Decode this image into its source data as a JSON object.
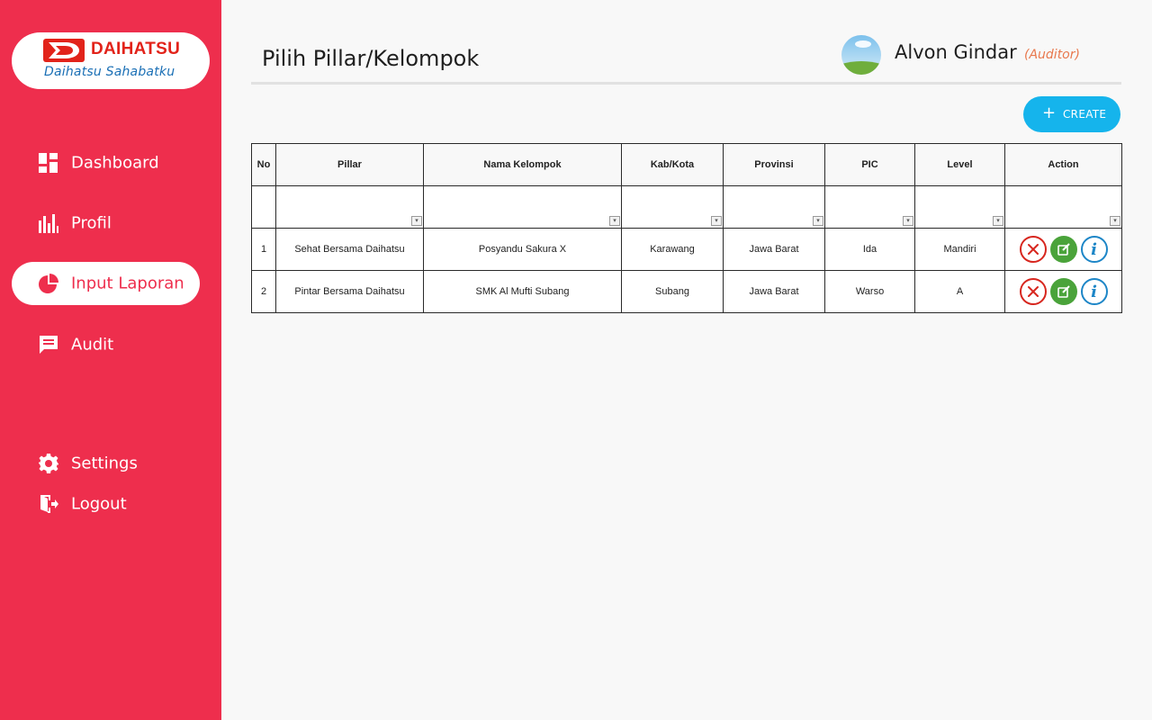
{
  "brand": {
    "name": "DAIHATSU",
    "tagline": "Daihatsu Sahabatku"
  },
  "sidebar": {
    "items": [
      {
        "label": "Dashboard",
        "icon": "dashboard-icon",
        "active": false
      },
      {
        "label": "Profil",
        "icon": "bar-chart-icon",
        "active": false
      },
      {
        "label": "Input Laporan",
        "icon": "pie-chart-icon",
        "active": true
      },
      {
        "label": "Audit",
        "icon": "message-icon",
        "active": false
      },
      {
        "label": "Settings",
        "icon": "gear-icon",
        "active": false
      },
      {
        "label": "Logout",
        "icon": "logout-icon",
        "active": false
      }
    ]
  },
  "header": {
    "title": "Pilih Pillar/Kelompok",
    "user_name": "Alvon Gindar",
    "user_role": "(Auditor)"
  },
  "toolbar": {
    "create_label": "CREATE"
  },
  "table": {
    "columns": [
      "No",
      "Pillar",
      "Nama Kelompok",
      "Kab/Kota",
      "Provinsi",
      "PIC",
      "Level",
      "Action"
    ],
    "rows": [
      [
        "1",
        "Sehat Bersama Daihatsu",
        "Posyandu Sakura X",
        "Karawang",
        "Jawa Barat",
        "Ida",
        "Mandiri"
      ],
      [
        "2",
        "Pintar Bersama Daihatsu",
        "SMK Al Mufti Subang",
        "Subang",
        "Jawa Barat",
        "Warso",
        "A"
      ]
    ]
  },
  "colors": {
    "sidebar": "#ee2e4d",
    "accent": "#15b4ec",
    "delete": "#d7261e",
    "edit": "#4aa33a",
    "info": "#1d86c7"
  }
}
